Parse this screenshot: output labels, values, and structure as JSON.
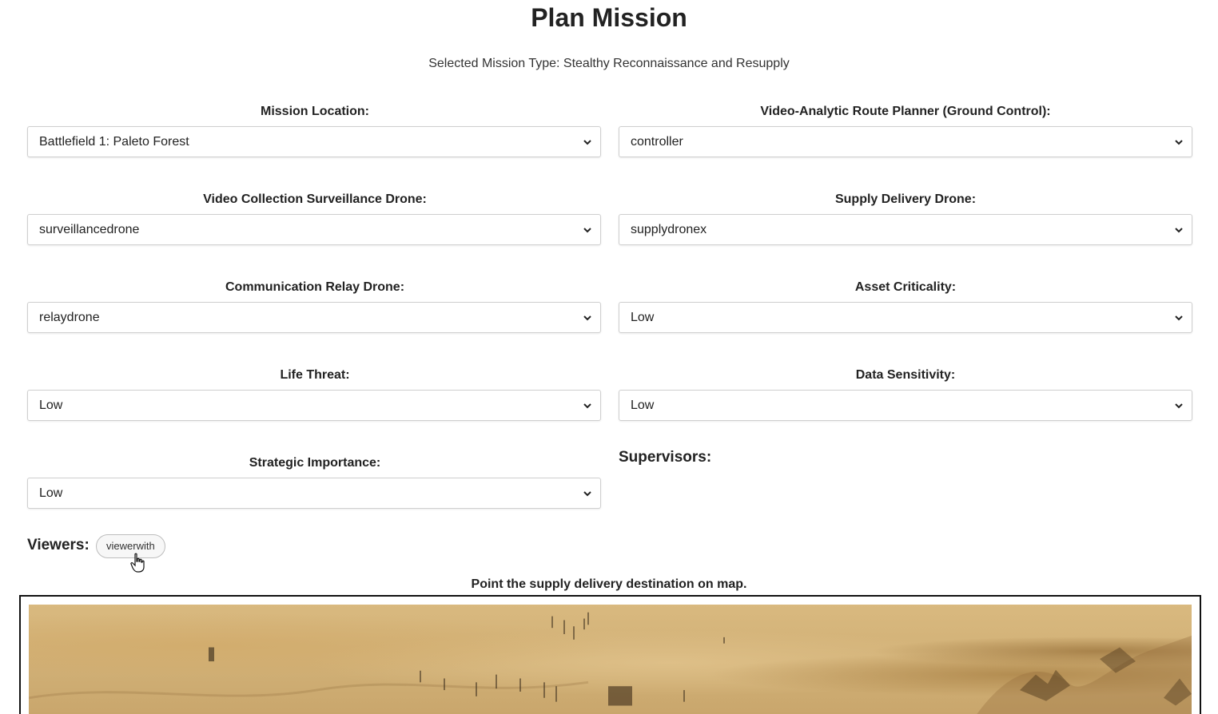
{
  "page": {
    "title": "Plan Mission",
    "subtitle": "Selected Mission Type: Stealthy Reconnaissance and Resupply"
  },
  "fields": {
    "mission_location": {
      "label": "Mission Location:",
      "value": "Battlefield 1: Paleto Forest"
    },
    "route_planner": {
      "label": "Video-Analytic Route Planner (Ground Control):",
      "value": "controller"
    },
    "surveillance_drone": {
      "label": "Video Collection Surveillance Drone:",
      "value": "surveillancedrone"
    },
    "supply_drone": {
      "label": "Supply Delivery Drone:",
      "value": "supplydronex"
    },
    "relay_drone": {
      "label": "Communication Relay Drone:",
      "value": "relaydrone"
    },
    "asset_criticality": {
      "label": "Asset Criticality:",
      "value": "Low"
    },
    "life_threat": {
      "label": "Life Threat:",
      "value": "Low"
    },
    "data_sensitivity": {
      "label": "Data Sensitivity:",
      "value": "Low"
    },
    "strategic_importance": {
      "label": "Strategic Importance:",
      "value": "Low"
    }
  },
  "supervisors": {
    "heading": "Supervisors:"
  },
  "viewers": {
    "heading": "Viewers:",
    "items": [
      "viewerwith"
    ]
  },
  "map": {
    "instruction": "Point the supply delivery destination on map."
  },
  "icons": {
    "select_arrow": "chevron-down-icon",
    "cursor": "hand-pointer-icon"
  }
}
